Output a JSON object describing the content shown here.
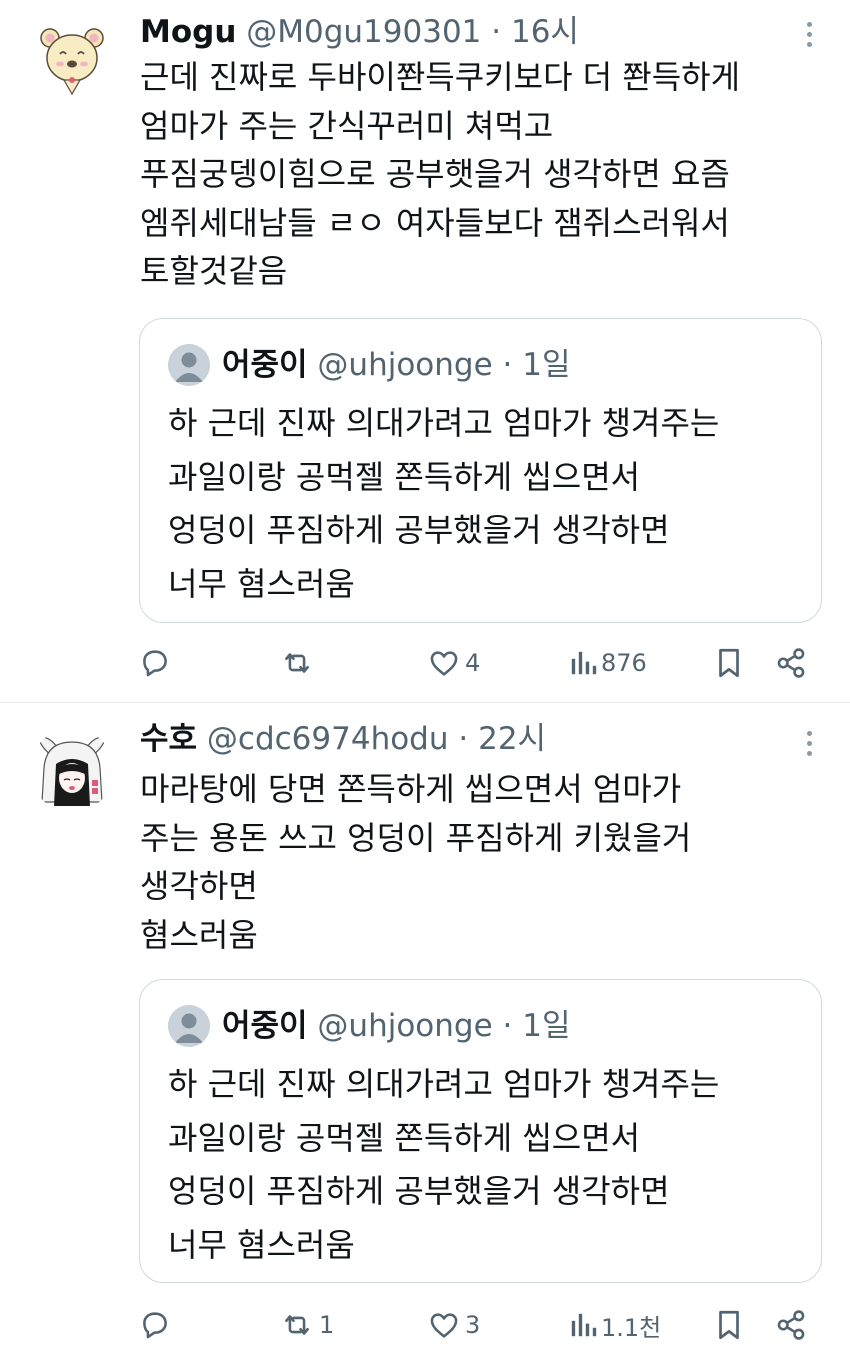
{
  "tweets": [
    {
      "name": "Mogu",
      "handle": "@M0gu190301",
      "dot": "·",
      "time": "16시",
      "lines": [
        "근데 진짜로 두바이쫜득쿠키보다 더 쫜득하게",
        "엄마가 주는 간식꾸러미 쳐먹고",
        "푸짐궁뎅이힘으로 공부햇을거 생각하면 요즘",
        "엠쥐세대남들 ㄹㅇ 여자들보다 잼쥐스러워서",
        "토할것같음"
      ],
      "quote": {
        "name": "어중이",
        "handle": "@uhjoonge",
        "dot": "·",
        "time": "1일",
        "lines": [
          "하 근데 진짜 의대가려고 엄마가 챙겨주는",
          "과일이랑 공먹젤 쫀득하게 씹으면서",
          "엉덩이 푸짐하게 공부했을거 생각하면",
          "너무 혐스러움"
        ]
      },
      "actions": {
        "reply": "",
        "retweet": "",
        "like": "4",
        "views": "876"
      }
    },
    {
      "name": "수호",
      "handle": "@cdc6974hodu",
      "dot": "·",
      "time": "22시",
      "lines": [
        "마라탕에 당면 쫀득하게 씹으면서 엄마가",
        "주는 용돈 쓰고 엉덩이 푸짐하게 키웠을거",
        "생각하면",
        "혐스러움"
      ],
      "quote": {
        "name": "어중이",
        "handle": "@uhjoonge",
        "dot": "·",
        "time": "1일",
        "lines": [
          "하 근데 진짜 의대가려고 엄마가 챙겨주는",
          "과일이랑 공먹젤 쫀득하게 씹으면서",
          "엉덩이 푸짐하게 공부했을거 생각하면",
          "너무 혐스러움"
        ]
      },
      "actions": {
        "reply": "",
        "retweet": "1",
        "like": "3",
        "views": "1.1천"
      }
    }
  ],
  "icons": {
    "reply": "reply-icon",
    "retweet": "retweet-icon",
    "like": "heart-icon",
    "views": "views-icon",
    "bookmark": "bookmark-icon",
    "share": "share-icon",
    "more": "more-icon"
  },
  "colors": {
    "text": "#0f1419",
    "secondary": "#536471",
    "border": "#cfd9de"
  }
}
